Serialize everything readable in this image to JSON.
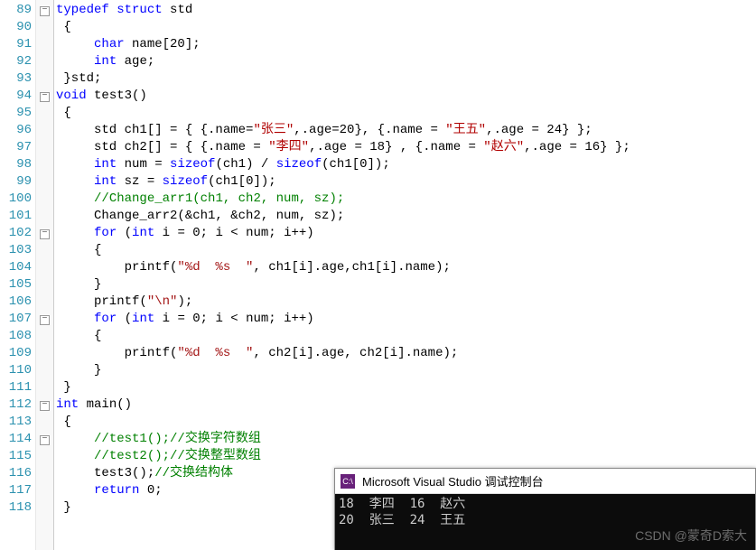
{
  "lines": [
    {
      "num": 89,
      "fold": "box-minus",
      "segs": [
        [
          "kw",
          "typedef"
        ],
        [
          "black",
          " "
        ],
        [
          "kw",
          "struct"
        ],
        [
          "black",
          " std"
        ]
      ]
    },
    {
      "num": 90,
      "segs": [
        [
          "black",
          " {"
        ]
      ]
    },
    {
      "num": 91,
      "segs": [
        [
          "black",
          "     "
        ],
        [
          "kw",
          "char"
        ],
        [
          "black",
          " name[20];"
        ]
      ]
    },
    {
      "num": 92,
      "segs": [
        [
          "black",
          "     "
        ],
        [
          "kw",
          "int"
        ],
        [
          "black",
          " age;"
        ]
      ]
    },
    {
      "num": 93,
      "segs": [
        [
          "black",
          " }std;"
        ]
      ]
    },
    {
      "num": 94,
      "fold": "box-minus",
      "segs": [
        [
          "kw",
          "void"
        ],
        [
          "black",
          " test3()"
        ]
      ]
    },
    {
      "num": 95,
      "segs": [
        [
          "black",
          " {"
        ]
      ]
    },
    {
      "num": 96,
      "segs": [
        [
          "black",
          "     std ch1[] = { {.name="
        ],
        [
          "darkred",
          "\"张三\""
        ],
        [
          "black",
          ",.age=20}, {.name = "
        ],
        [
          "darkred",
          "\"王五\""
        ],
        [
          "black",
          ",.age = 24} };"
        ]
      ]
    },
    {
      "num": 97,
      "segs": [
        [
          "black",
          "     std ch2[] = { {.name = "
        ],
        [
          "darkred",
          "\"李四\""
        ],
        [
          "black",
          ",.age = 18} , {.name = "
        ],
        [
          "darkred",
          "\"赵六\""
        ],
        [
          "black",
          ",.age = 16} };"
        ]
      ]
    },
    {
      "num": 98,
      "segs": [
        [
          "black",
          "     "
        ],
        [
          "kw",
          "int"
        ],
        [
          "black",
          " num = "
        ],
        [
          "kw",
          "sizeof"
        ],
        [
          "black",
          "(ch1) / "
        ],
        [
          "kw",
          "sizeof"
        ],
        [
          "black",
          "(ch1[0]);"
        ]
      ]
    },
    {
      "num": 99,
      "segs": [
        [
          "black",
          "     "
        ],
        [
          "kw",
          "int"
        ],
        [
          "black",
          " sz = "
        ],
        [
          "kw",
          "sizeof"
        ],
        [
          "black",
          "(ch1[0]);"
        ]
      ]
    },
    {
      "num": 100,
      "segs": [
        [
          "black",
          "     "
        ],
        [
          "green",
          "//Change_arr1(ch1, ch2, num, sz);"
        ]
      ]
    },
    {
      "num": 101,
      "segs": [
        [
          "black",
          "     Change_arr2(&ch1, &ch2, num, sz);"
        ]
      ]
    },
    {
      "num": 102,
      "fold": "box-minus",
      "segs": [
        [
          "black",
          "     "
        ],
        [
          "kw",
          "for"
        ],
        [
          "black",
          " ("
        ],
        [
          "kw",
          "int"
        ],
        [
          "black",
          " i = 0; i < num; i++)"
        ]
      ]
    },
    {
      "num": 103,
      "segs": [
        [
          "black",
          "     {"
        ]
      ]
    },
    {
      "num": 104,
      "segs": [
        [
          "black",
          "         printf("
        ],
        [
          "red",
          "\"%d  %s  \""
        ],
        [
          "black",
          ", ch1[i].age,ch1[i].name);"
        ]
      ]
    },
    {
      "num": 105,
      "segs": [
        [
          "black",
          "     }"
        ]
      ]
    },
    {
      "num": 106,
      "segs": [
        [
          "black",
          "     printf("
        ],
        [
          "red",
          "\"\\n\""
        ],
        [
          "black",
          ");"
        ]
      ]
    },
    {
      "num": 107,
      "fold": "box-minus",
      "segs": [
        [
          "black",
          "     "
        ],
        [
          "kw",
          "for"
        ],
        [
          "black",
          " ("
        ],
        [
          "kw",
          "int"
        ],
        [
          "black",
          " i = 0; i < num; i++)"
        ]
      ]
    },
    {
      "num": 108,
      "segs": [
        [
          "black",
          "     {"
        ]
      ]
    },
    {
      "num": 109,
      "segs": [
        [
          "black",
          "         printf("
        ],
        [
          "red",
          "\"%d  %s  \""
        ],
        [
          "black",
          ", ch2[i].age, ch2[i].name);"
        ]
      ]
    },
    {
      "num": 110,
      "segs": [
        [
          "black",
          "     }"
        ]
      ]
    },
    {
      "num": 111,
      "segs": [
        [
          "black",
          " }"
        ]
      ]
    },
    {
      "num": 112,
      "fold": "box-minus",
      "segs": [
        [
          "kw",
          "int"
        ],
        [
          "black",
          " main()"
        ]
      ]
    },
    {
      "num": 113,
      "segs": [
        [
          "black",
          " {"
        ]
      ]
    },
    {
      "num": 114,
      "fold": "box-minus",
      "segs": [
        [
          "black",
          "     "
        ],
        [
          "green",
          "//test1();//交换字符数组"
        ]
      ]
    },
    {
      "num": 115,
      "segs": [
        [
          "black",
          "     "
        ],
        [
          "green",
          "//test2();//交换整型数组"
        ]
      ]
    },
    {
      "num": 116,
      "segs": [
        [
          "black",
          "     test3();"
        ],
        [
          "green",
          "//交换结构体"
        ]
      ]
    },
    {
      "num": 117,
      "segs": [
        [
          "black",
          "     "
        ],
        [
          "kw",
          "return"
        ],
        [
          "black",
          " 0;"
        ]
      ]
    },
    {
      "num": 118,
      "segs": [
        [
          "black",
          " }"
        ]
      ]
    }
  ],
  "console": {
    "title": "Microsoft Visual Studio 调试控制台",
    "icon": "C:\\",
    "output": [
      "18  李四  16  赵六",
      "20  张三  24  王五"
    ]
  },
  "watermark": "CSDN @蒙奇D索大"
}
